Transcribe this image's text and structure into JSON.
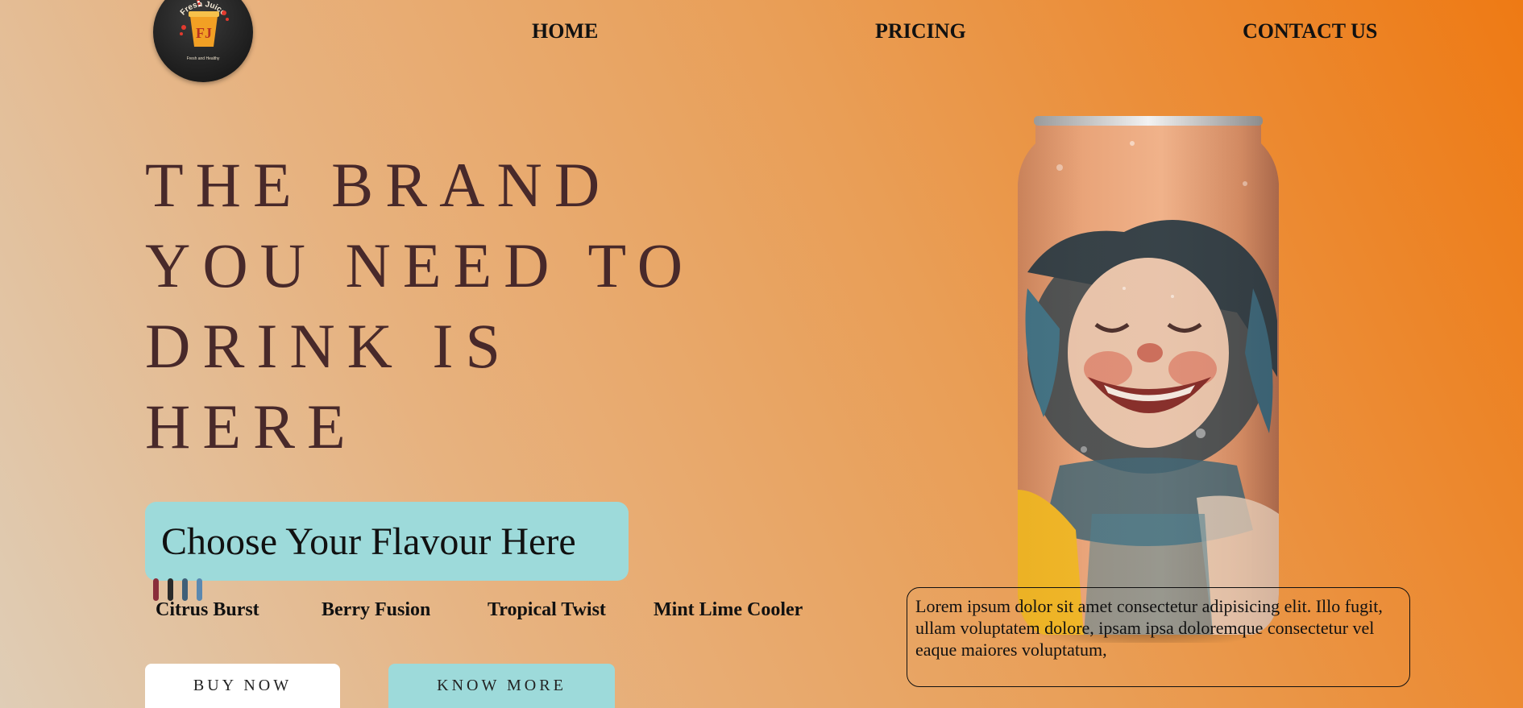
{
  "logo": {
    "brand_name": "Fresh Juice",
    "monogram": "FJ",
    "tagline": "Fresh and Healthy"
  },
  "nav": {
    "home": "HOME",
    "pricing": "PRICING",
    "contact": "CONTACT US"
  },
  "hero": {
    "title_lines": [
      "THE BRAND",
      "YOU NEED TO",
      "DRINK IS",
      "HERE"
    ]
  },
  "flavour_picker": {
    "heading": "Choose Your Flavour Here",
    "swatch_colors": [
      "#8a2d3a",
      "#2a2a2a",
      "#3f5f78",
      "#5a88b0"
    ],
    "flavors": [
      "Citrus Burst",
      "Berry Fusion",
      "Tropical Twist",
      "Mint Lime Cooler"
    ]
  },
  "buttons": {
    "buy": "BUY NOW",
    "know_more": "KNOW MORE"
  },
  "description": "Lorem ipsum dolor sit amet consectetur adipisicing elit. Illo fugit, ullam voluptatem dolore, ipsam ipsa doloremque consectetur vel eaque maiores voluptatum,",
  "colors": {
    "accent": "#9ddada",
    "title": "#48292a",
    "background_start": "#dfcdb6",
    "background_end": "#ee7a14"
  }
}
